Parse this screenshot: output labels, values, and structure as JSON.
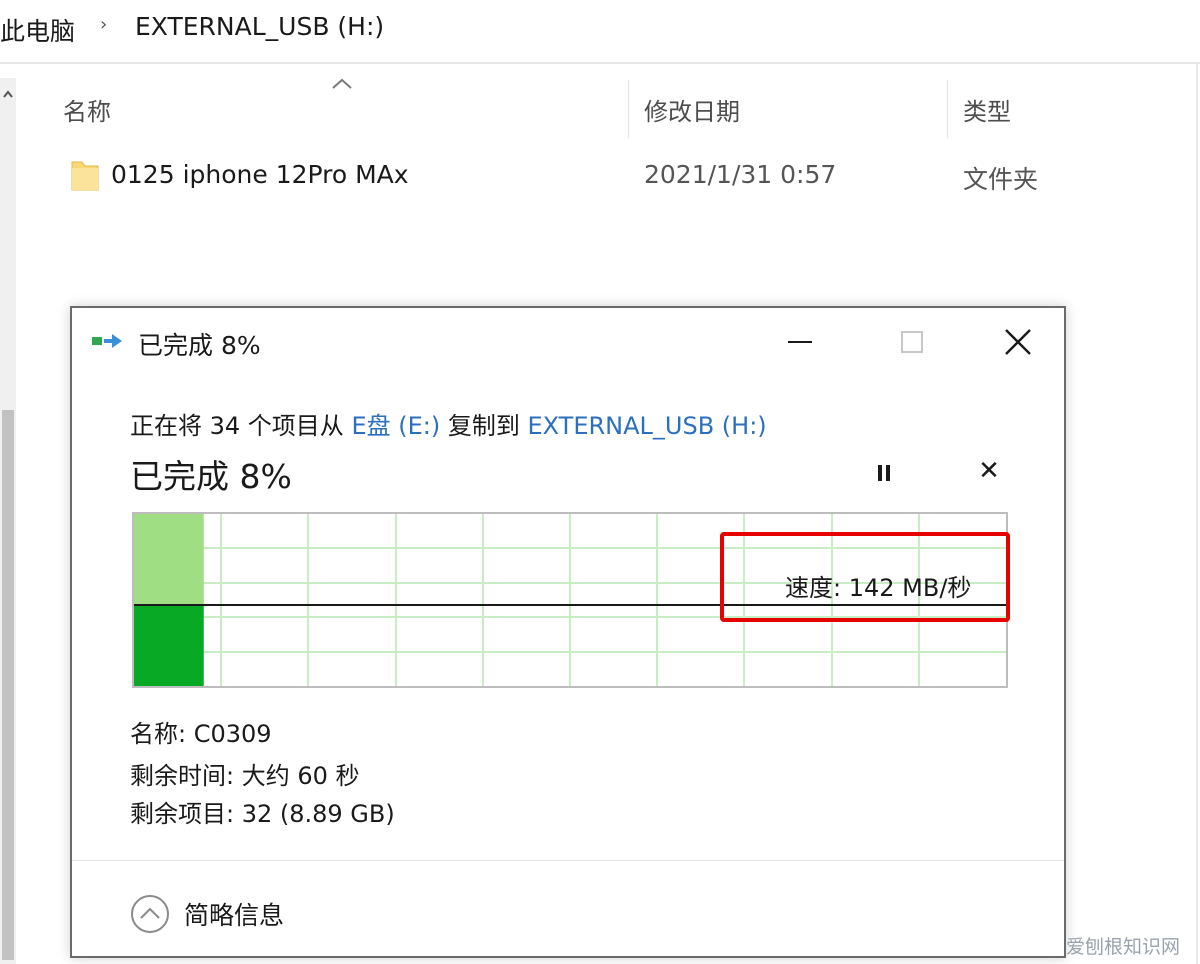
{
  "breadcrumb": {
    "root": "此电脑",
    "separator": "›",
    "current": "EXTERNAL_USB (H:)"
  },
  "columns": {
    "name": "名称",
    "modified": "修改日期",
    "type": "类型"
  },
  "files": [
    {
      "name": "0125 iphone 12Pro MAx",
      "modified": "2021/1/31 0:57",
      "type": "文件夹"
    }
  ],
  "dialog": {
    "title": "已完成 8%",
    "description": {
      "prefix": "正在将 34 个项目从 ",
      "source": "E盘 (E:)",
      "middle": " 复制到 ",
      "destination": "EXTERNAL_USB (H:)"
    },
    "progress_text": "已完成 8%",
    "progress_percent": 8,
    "cancel_symbol": "✕",
    "speed_text": "速度: 142 MB/秒",
    "details": {
      "name": "名称: C0309",
      "time_remaining": "剩余时间: 大约 60 秒",
      "items_remaining": "剩余项目: 32 (8.89 GB)"
    },
    "less_details": "简略信息"
  },
  "colors": {
    "progress_green": "#07a925",
    "progress_light_green": "#9fde82",
    "grid_green": "#c8ecc4",
    "link_blue": "#2b6fbf",
    "highlight_red": "#e60000"
  },
  "watermark": "爱刨根知识网"
}
